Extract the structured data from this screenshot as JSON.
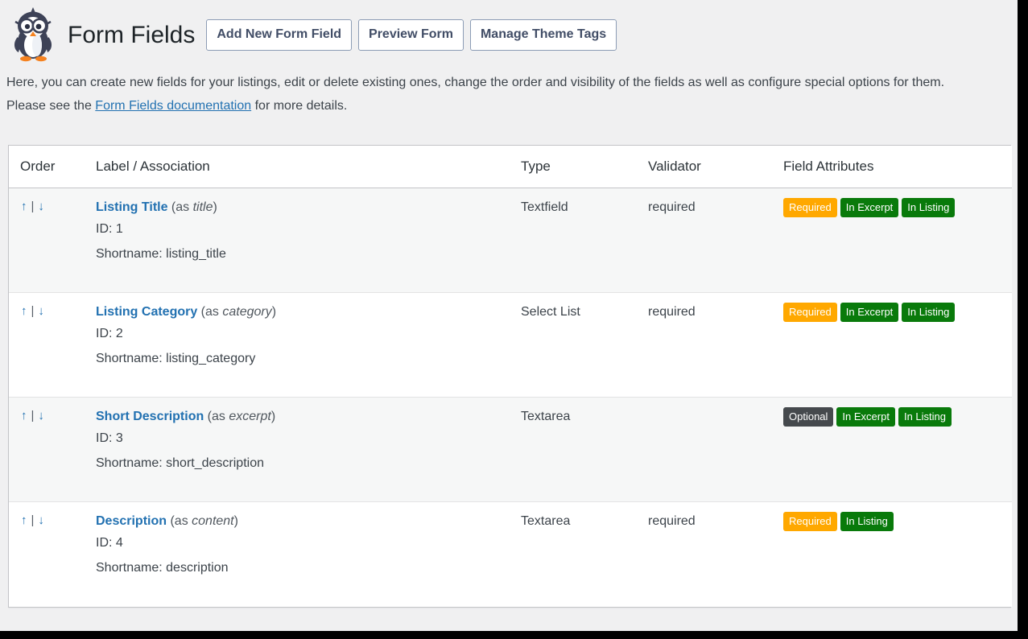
{
  "header": {
    "logo_icon": "penguin-logo-icon",
    "title": "Form Fields",
    "buttons": [
      {
        "label": "Add New Form Field",
        "name": "add-new-form-field-button"
      },
      {
        "label": "Preview Form",
        "name": "preview-form-button"
      },
      {
        "label": "Manage Theme Tags",
        "name": "manage-theme-tags-button"
      }
    ]
  },
  "intro": {
    "paragraph1": "Here, you can create new fields for your listings, edit or delete existing ones, change the order and visibility of the fields as well as configure special options for them.",
    "line2_before": "Please see the ",
    "link_text": "Form Fields documentation",
    "line2_after": " for more details."
  },
  "table": {
    "columns": [
      "Order",
      "Label / Association",
      "Type",
      "Validator",
      "Field Attributes"
    ],
    "order_controls": {
      "up": "↑",
      "separator": "|",
      "down": "↓"
    },
    "rows": [
      {
        "label": "Listing Title",
        "association_prefix": "(as ",
        "association": "title",
        "association_suffix": ")",
        "id_text": "ID: 1",
        "shortname_text": "Shortname: listing_title",
        "type": "Textfield",
        "validator": "required",
        "attributes": [
          {
            "text": "Required",
            "style": "required"
          },
          {
            "text": "In Excerpt",
            "style": "green"
          },
          {
            "text": "In Listing",
            "style": "green"
          }
        ]
      },
      {
        "label": "Listing Category",
        "association_prefix": "(as ",
        "association": "category",
        "association_suffix": ")",
        "id_text": "ID: 2",
        "shortname_text": "Shortname: listing_category",
        "type": "Select List",
        "validator": "required",
        "attributes": [
          {
            "text": "Required",
            "style": "required"
          },
          {
            "text": "In Excerpt",
            "style": "green"
          },
          {
            "text": "In Listing",
            "style": "green"
          }
        ]
      },
      {
        "label": "Short Description",
        "association_prefix": "(as ",
        "association": "excerpt",
        "association_suffix": ")",
        "id_text": "ID: 3",
        "shortname_text": "Shortname: short_description",
        "type": "Textarea",
        "validator": "",
        "attributes": [
          {
            "text": "Optional",
            "style": "optional"
          },
          {
            "text": "In Excerpt",
            "style": "green"
          },
          {
            "text": "In Listing",
            "style": "green"
          }
        ]
      },
      {
        "label": "Description",
        "association_prefix": "(as ",
        "association": "content",
        "association_suffix": ")",
        "id_text": "ID: 4",
        "shortname_text": "Shortname: description",
        "type": "Textarea",
        "validator": "required",
        "attributes": [
          {
            "text": "Required",
            "style": "required"
          },
          {
            "text": "In Listing",
            "style": "green"
          }
        ]
      }
    ]
  },
  "colors": {
    "link": "#2271b1",
    "badge_required": "#ffa800",
    "badge_optional": "#45494d",
    "badge_green": "#097a0b",
    "page_bg": "#f0f0f1",
    "row_alt_bg": "#f6f7f7"
  }
}
